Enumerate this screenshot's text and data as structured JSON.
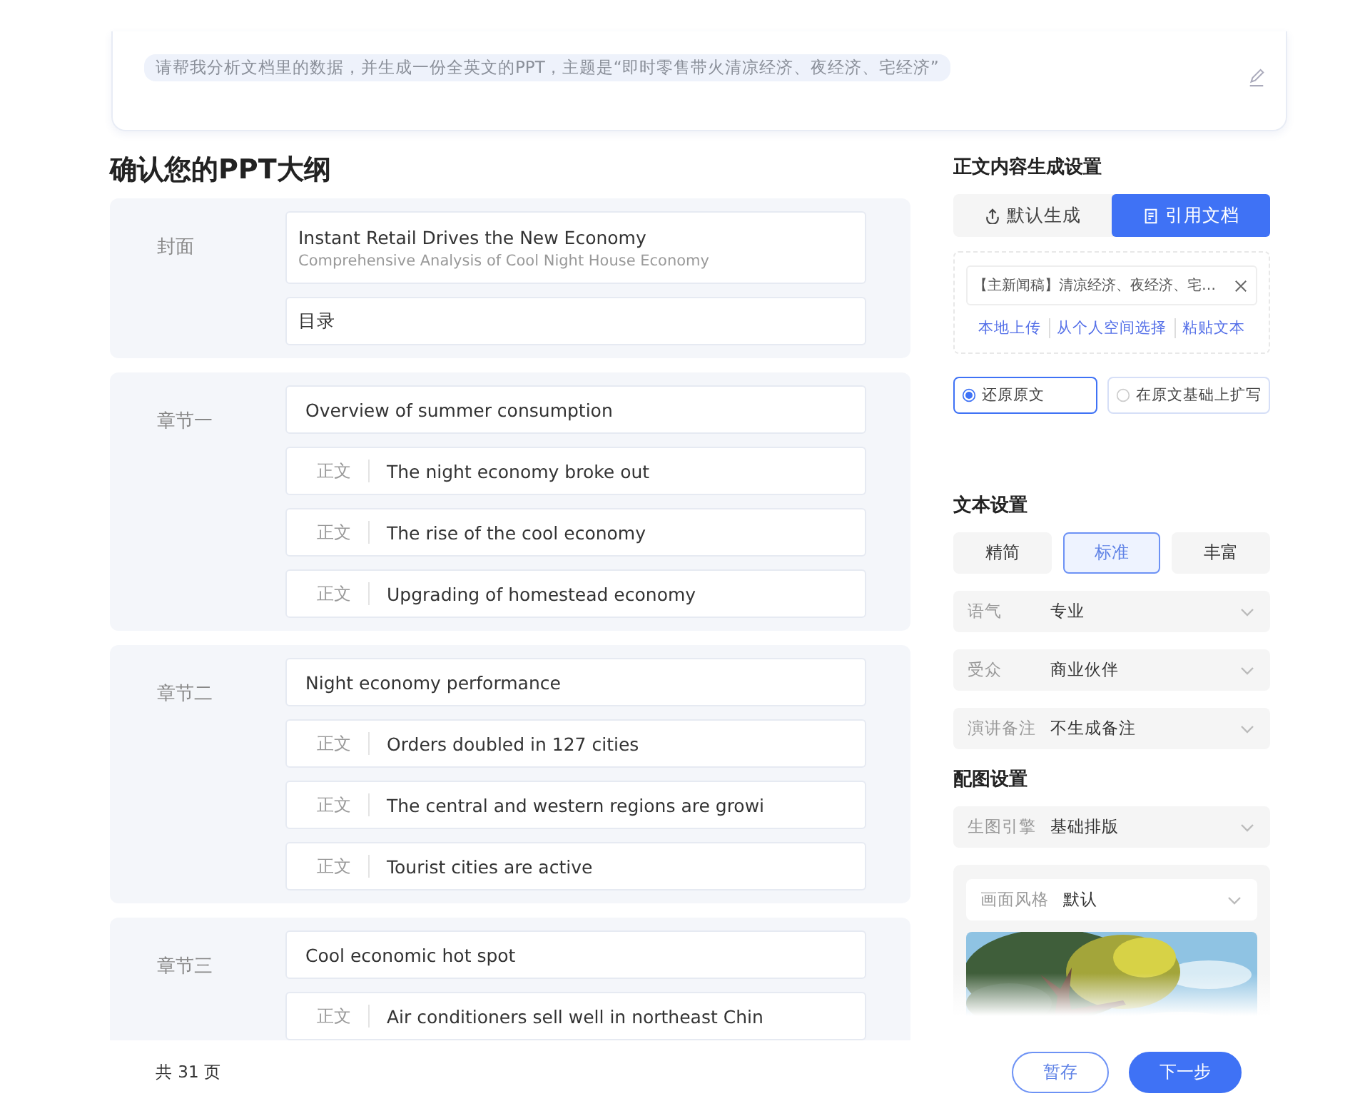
{
  "prompt": {
    "text": "请帮我分析文档里的数据，并生成一份全英文的PPT，主题是“即时零售带火清凉经济、夜经济、宅经济”"
  },
  "outline": {
    "title": "确认您的PPT大纲",
    "sections": [
      {
        "label": "封面",
        "items": [
          {
            "kind": "cover",
            "title": "Instant Retail Drives the New Economy",
            "subtitle": "Comprehensive Analysis of Cool Night House Economy"
          },
          {
            "kind": "plain",
            "text": "目录"
          }
        ]
      },
      {
        "label": "章节一",
        "items": [
          {
            "kind": "heading",
            "text": "Overview of summer consumption"
          },
          {
            "kind": "body",
            "tag": "正文",
            "text": "The night economy broke out"
          },
          {
            "kind": "body",
            "tag": "正文",
            "text": "The rise of the cool economy"
          },
          {
            "kind": "body",
            "tag": "正文",
            "text": "Upgrading of homestead economy"
          }
        ]
      },
      {
        "label": "章节二",
        "items": [
          {
            "kind": "heading",
            "text": "Night economy performance"
          },
          {
            "kind": "body",
            "tag": "正文",
            "text": "Orders doubled in 127 cities"
          },
          {
            "kind": "body",
            "tag": "正文",
            "text": "The central and western regions are growi"
          },
          {
            "kind": "body",
            "tag": "正文",
            "text": "Tourist cities are active"
          }
        ]
      },
      {
        "label": "章节三",
        "items": [
          {
            "kind": "heading",
            "text": "Cool economic hot spot"
          },
          {
            "kind": "body",
            "tag": "正文",
            "text": "Air conditioners sell well in northeast Chin"
          }
        ]
      }
    ]
  },
  "settings": {
    "title": "正文内容生成设置",
    "mode_tabs": [
      {
        "label": "默认生成",
        "selected": false
      },
      {
        "label": "引用文档",
        "selected": true
      }
    ],
    "document": {
      "name": "【主新闻稿】清凉经济、夜经济、宅…"
    },
    "links": [
      "本地上传",
      "从个人空间选择",
      "粘贴文本"
    ],
    "source_options": [
      {
        "label": "还原原文",
        "selected": true
      },
      {
        "label": "在原文基础上扩写",
        "selected": false
      }
    ],
    "text_title": "文本设置",
    "length_options": [
      {
        "label": "精简",
        "selected": false
      },
      {
        "label": "标准",
        "selected": true
      },
      {
        "label": "丰富",
        "selected": false
      }
    ],
    "text_selects": [
      {
        "label": "语气",
        "value": "专业"
      },
      {
        "label": "受众",
        "value": "商业伙伴"
      },
      {
        "label": "演讲备注",
        "value": "不生成备注"
      }
    ],
    "image_title": "配图设置",
    "image_selects": [
      {
        "label": "生图引擎",
        "value": "基础排版"
      }
    ],
    "style_select": {
      "label": "画面风格",
      "value": "默认"
    },
    "style_preview": {
      "kind": "picture"
    }
  },
  "footer": {
    "page_count": "共 31 页",
    "buttons": [
      {
        "label": "暂存",
        "kind": "secondary"
      },
      {
        "label": "下一步",
        "kind": "primary"
      }
    ]
  }
}
